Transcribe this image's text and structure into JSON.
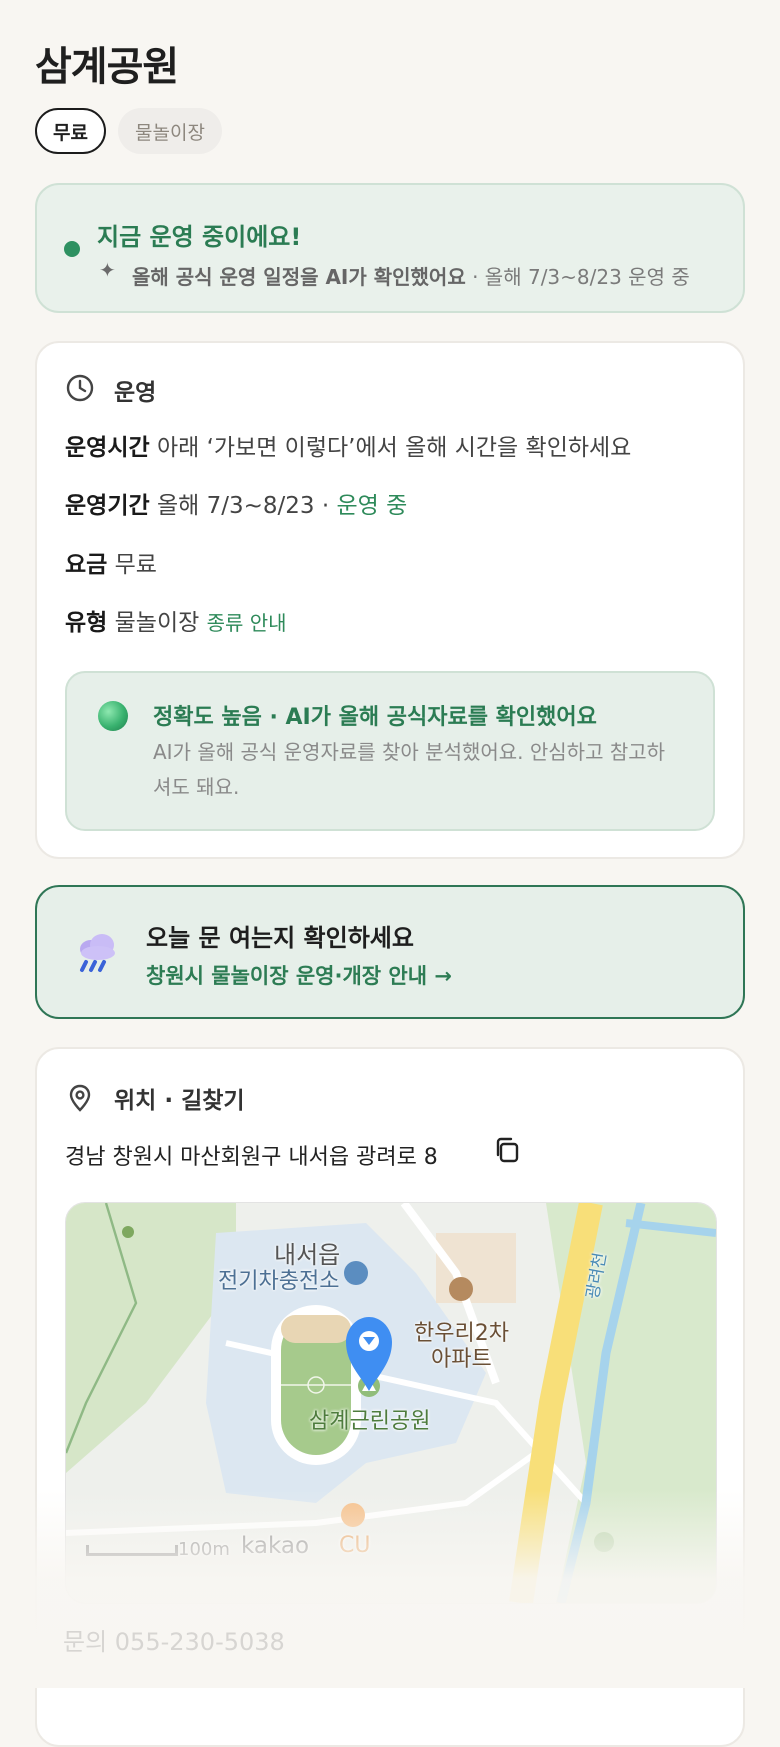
{
  "page": {
    "title": "삼계공원",
    "tags": [
      "무료",
      "물놀이장"
    ]
  },
  "status": {
    "title": "지금 운영 중이에요!",
    "ai_note": "올해 공식 운영 일정을 AI가 확인했어요",
    "period_note": " · 올해 7/3~8/23 운영 중"
  },
  "operation": {
    "section_title": "운영",
    "hours_label": "운영시간",
    "hours_value": "아래 ‘가보면 이렇다’에서 올해 시간을 확인하세요",
    "period_label": "운영기간",
    "period_value": "올해 7/3~8/23 · ",
    "period_status": "운영 중",
    "fee_label": "요금",
    "fee_value": "무료",
    "type_label": "유형",
    "type_value": "물놀이장",
    "type_link": "종류 안내",
    "accuracy_title": "정확도 높음 · AI가 올해 공식자료를 확인했어요",
    "accuracy_text": "AI가 올해 공식 운영자료를 찾아 분석했어요. 안심하고 참고하셔도 돼요."
  },
  "check_open": {
    "title": "오늘 문 여는지 확인하세요",
    "link": "창원시 물놀이장 운영·개장 안내 →"
  },
  "location": {
    "section_title": "위치 · 길찾기",
    "address": "경남 창원시 마산회원구 내서읍 광려로 8",
    "map": {
      "label_town": "내서읍",
      "label_ev": "전기차충전소",
      "label_apt_1": "한우리2차",
      "label_apt_2": "아파트",
      "label_park": "삼계근린공원",
      "label_stream": "광려천",
      "label_store": "CU",
      "scale": "100m",
      "provider": "kakao"
    }
  },
  "contact": {
    "phone": "문의 055-230-5038"
  },
  "colors": {
    "accent_green": "#2e8a5a",
    "status_bg": "#e9f1eb",
    "pin_blue": "#3f8ef2",
    "road_yellow": "#f8df79"
  }
}
